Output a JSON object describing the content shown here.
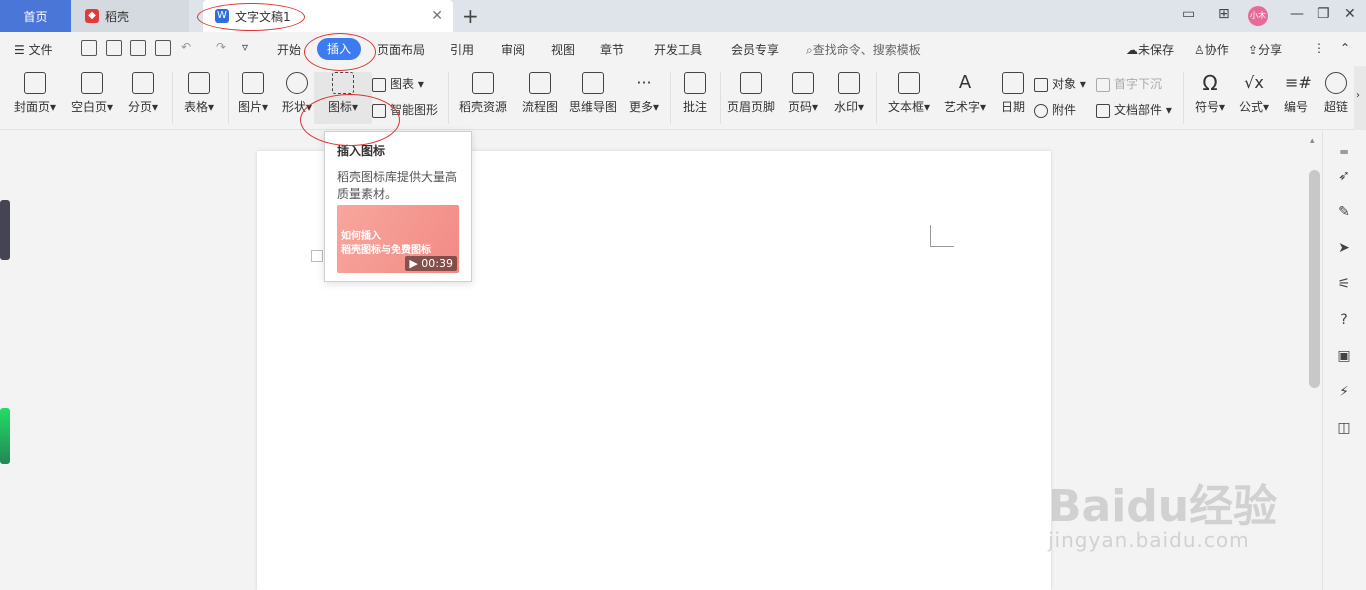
{
  "titlebar": {
    "tabs": [
      {
        "label": "首页"
      },
      {
        "label": "稻壳"
      },
      {
        "label": "文字文稿1"
      }
    ],
    "avatar_text": "小木"
  },
  "menubar": {
    "file": "文件",
    "items": [
      "开始",
      "插入",
      "页面布局",
      "引用",
      "审阅",
      "视图",
      "章节",
      "开发工具",
      "会员专享"
    ],
    "active": "插入",
    "search_placeholder": "查找命令、搜索模板",
    "right": [
      "未保存",
      "协作",
      "分享"
    ]
  },
  "ribbon": {
    "cover": "封面页",
    "blank": "空白页",
    "pagebreak": "分页",
    "table": "表格",
    "picture": "图片",
    "shape": "形状",
    "icon": "图标",
    "chart": "图表",
    "smartart": "智能图形",
    "daoke": "稻壳资源",
    "flowchart": "流程图",
    "mindmap": "思维导图",
    "more": "更多",
    "comment": "批注",
    "header_footer": "页眉页脚",
    "page_number": "页码",
    "watermark": "水印",
    "textbox": "文本框",
    "wordart": "艺术字",
    "date": "日期",
    "object": "对象",
    "attachment": "附件",
    "dropcap": "首字下沉",
    "doc_parts": "文档部件",
    "symbol": "符号",
    "formula": "公式",
    "numbering": "编号",
    "hyperlink": "超链"
  },
  "tooltip": {
    "title": "插入图标",
    "desc": "稻壳图标库提供大量高质量素材。",
    "thumb_line1": "如何插入",
    "thumb_line2": "稻壳图标与免费图标",
    "duration": "00:39"
  },
  "watermark": {
    "big": "Baidu经验",
    "small": "jingyan.baidu.com"
  },
  "colors": {
    "accent": "#3d7cf0",
    "home_tab": "#4a76d8",
    "annotation": "#dd3333"
  }
}
